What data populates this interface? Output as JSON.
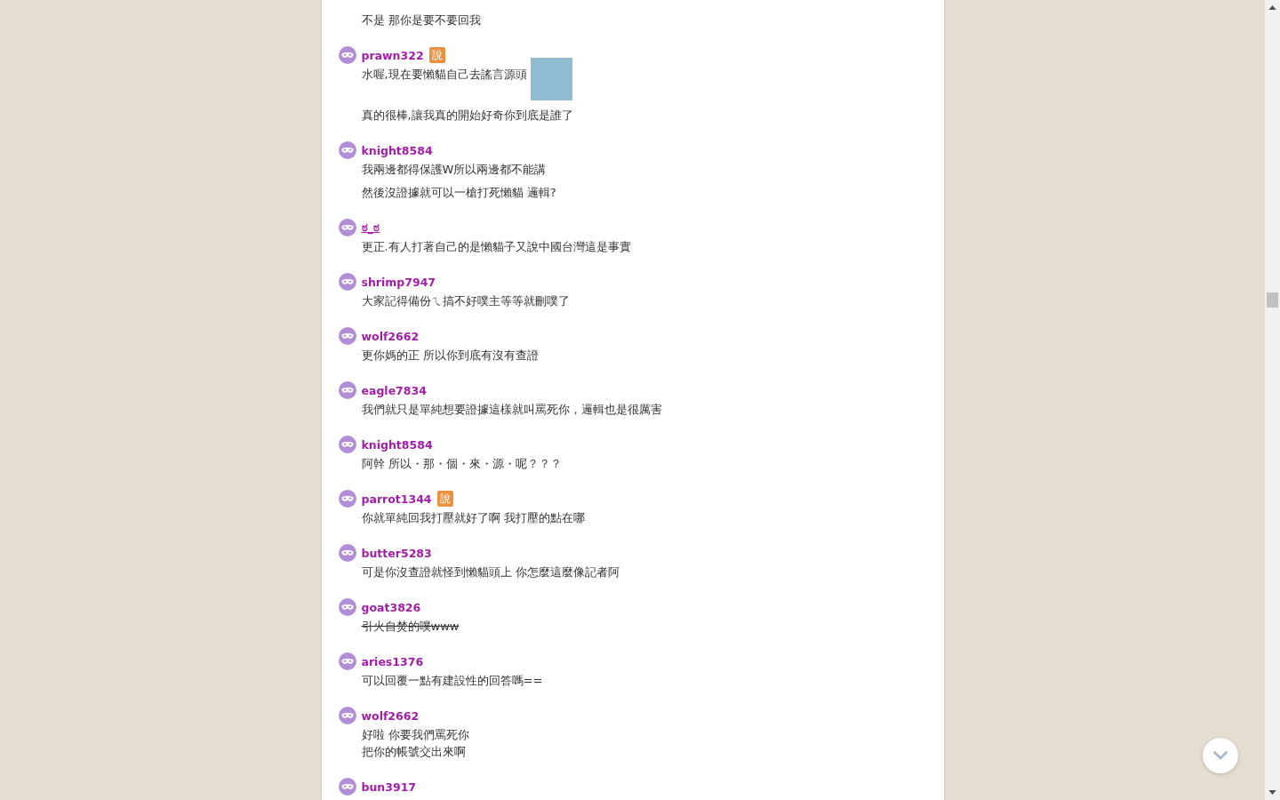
{
  "comments": [
    {
      "paragraphs": [
        {
          "parts": [
            {
              "kind": "text",
              "text": "不是 那你是要不要回我"
            }
          ]
        }
      ]
    },
    {
      "user": "prawn322",
      "badge": "說",
      "paragraphs": [
        {
          "parts": [
            {
              "kind": "text",
              "text": "水喔,現在要懶貓自己去謠言源頭"
            },
            {
              "kind": "photo"
            }
          ]
        },
        {
          "parts": [
            {
              "kind": "text",
              "text": "真的很棒,讓我真的開始好奇你到底是誰了"
            }
          ]
        }
      ]
    },
    {
      "user": "knight8584",
      "paragraphs": [
        {
          "parts": [
            {
              "kind": "text",
              "text": "我兩邊都得保護W所以兩邊都不能講"
            }
          ]
        },
        {
          "parts": [
            {
              "kind": "text",
              "text": "然後沒證據就可以一槍打死懶貓 邏輯?"
            }
          ]
        }
      ]
    },
    {
      "user": "ಠ_ಠ",
      "underlined": true,
      "paragraphs": [
        {
          "parts": [
            {
              "kind": "text",
              "text": "更正.有人打著自己的是懶貓子又說中國台灣這是事實"
            }
          ]
        }
      ]
    },
    {
      "user": "shrimp7947",
      "paragraphs": [
        {
          "parts": [
            {
              "kind": "text",
              "text": "大家記得備份ㄟ搞不好噗主等等就刪噗了"
            }
          ]
        }
      ]
    },
    {
      "user": "wolf2662",
      "paragraphs": [
        {
          "parts": [
            {
              "kind": "text",
              "text": "更你媽的正 所以你到底有沒有查證"
            }
          ]
        }
      ]
    },
    {
      "user": "eagle7834",
      "paragraphs": [
        {
          "parts": [
            {
              "kind": "text",
              "text": "我們就只是單純想要證據這樣就叫罵死你，邏輯也是很厲害"
            }
          ]
        }
      ]
    },
    {
      "user": "knight8584",
      "paragraphs": [
        {
          "parts": [
            {
              "kind": "text",
              "text": "阿幹 所以・那・個・來・源・呢？？？"
            }
          ]
        }
      ]
    },
    {
      "user": "parrot1344",
      "badge": "說",
      "paragraphs": [
        {
          "parts": [
            {
              "kind": "text",
              "text": "你就單純回我打壓就好了啊 我打壓的點在哪"
            }
          ]
        }
      ]
    },
    {
      "user": "butter5283",
      "paragraphs": [
        {
          "parts": [
            {
              "kind": "text",
              "text": "可是你沒查證就怪到懶貓頭上 你怎麼這麼像記者阿"
            }
          ]
        }
      ]
    },
    {
      "user": "goat3826",
      "struck": true,
      "paragraphs": [
        {
          "parts": [
            {
              "kind": "text",
              "text": "引火自焚的噗www"
            }
          ]
        }
      ]
    },
    {
      "user": "aries1376",
      "paragraphs": [
        {
          "parts": [
            {
              "kind": "text",
              "text": "可以回覆一點有建設性的回答嗎=="
            }
          ]
        }
      ]
    },
    {
      "user": "wolf2662",
      "paragraphs": [
        {
          "parts": [
            {
              "kind": "text",
              "text": "好啦 你要我們罵死你"
            },
            {
              "kind": "break"
            },
            {
              "kind": "text",
              "text": "把你的帳號交出來啊"
            }
          ]
        }
      ]
    },
    {
      "user": "bun3917"
    }
  ]
}
